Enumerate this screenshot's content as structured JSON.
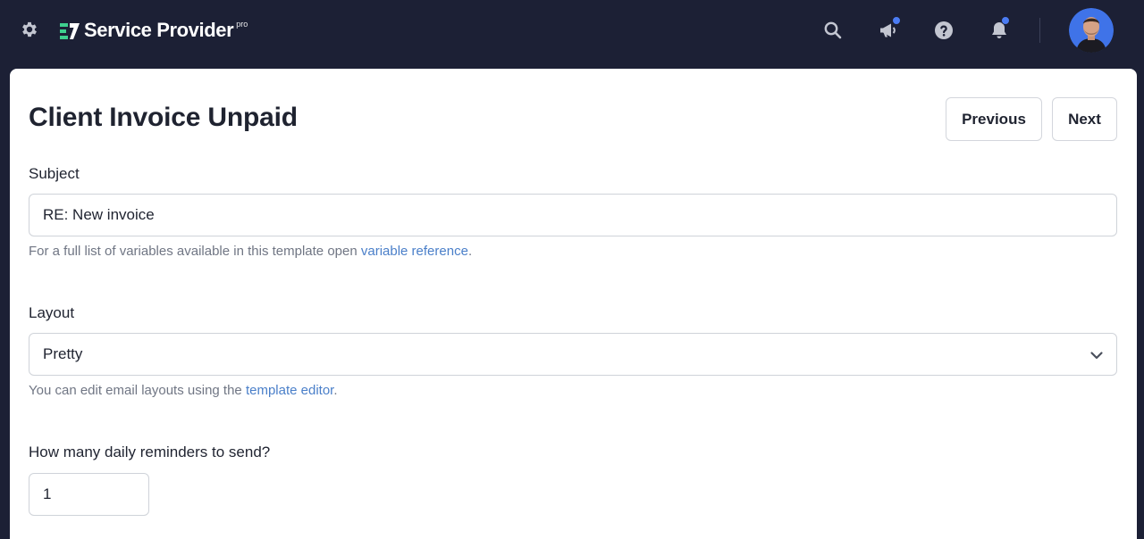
{
  "header": {
    "brand_name": "Service Provider",
    "brand_badge": "pro",
    "icons": [
      "gear-icon",
      "search-icon",
      "megaphone-icon",
      "help-icon",
      "bell-icon"
    ],
    "accent_color": "#4b7cf3",
    "background_color": "#1c2035"
  },
  "page": {
    "title": "Client Invoice Unpaid",
    "previous_label": "Previous",
    "next_label": "Next"
  },
  "form": {
    "subject": {
      "label": "Subject",
      "value": "RE: New invoice",
      "help_prefix": "For a full list of variables available in this template open ",
      "help_link": "variable reference",
      "help_suffix": "."
    },
    "layout": {
      "label": "Layout",
      "selected": "Pretty",
      "help_prefix": "You can edit email layouts using the ",
      "help_link": "template editor",
      "help_suffix": "."
    },
    "reminders": {
      "label": "How many daily reminders to send?",
      "value": "1"
    }
  }
}
